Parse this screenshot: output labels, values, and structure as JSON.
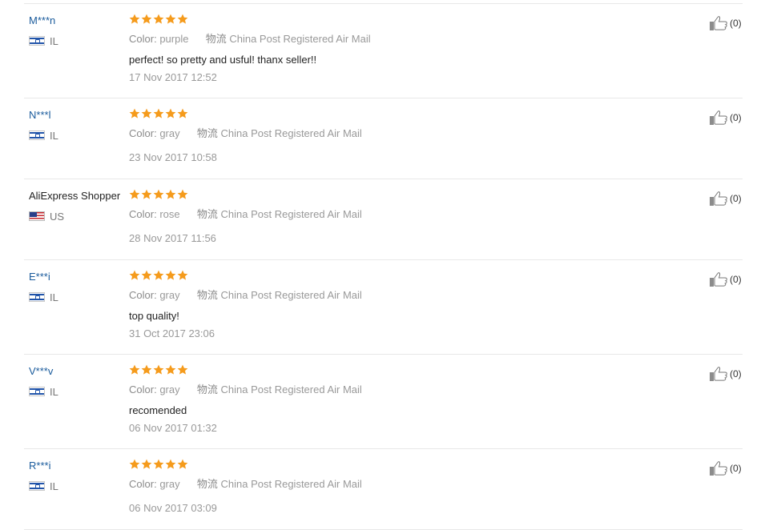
{
  "labels": {
    "color": "Color:",
    "shipping": "物流"
  },
  "reviews": [
    {
      "user": "M***n",
      "name_style": "masked",
      "flag": "il",
      "country": "IL",
      "stars": 5,
      "color": "purple",
      "shipping": "China Post Registered Air Mail",
      "feedback": "perfect! so pretty and usful! thanx seller!!",
      "date": "17 Nov 2017 12:52",
      "helpful": "(0)"
    },
    {
      "user": "N***l",
      "name_style": "masked",
      "flag": "il",
      "country": "IL",
      "stars": 5,
      "color": "gray",
      "shipping": "China Post Registered Air Mail",
      "feedback": "",
      "date": "23 Nov 2017 10:58",
      "helpful": "(0)"
    },
    {
      "user": "AliExpress Shopper",
      "name_style": "plain",
      "flag": "us",
      "country": "US",
      "stars": 5,
      "color": "rose",
      "shipping": "China Post Registered Air Mail",
      "feedback": "",
      "date": "28 Nov 2017 11:56",
      "helpful": "(0)"
    },
    {
      "user": "E***i",
      "name_style": "masked",
      "flag": "il",
      "country": "IL",
      "stars": 5,
      "color": "gray",
      "shipping": "China Post Registered Air Mail",
      "feedback": "top quality!",
      "date": "31 Oct 2017 23:06",
      "helpful": "(0)"
    },
    {
      "user": "V***v",
      "name_style": "masked",
      "flag": "il",
      "country": "IL",
      "stars": 5,
      "color": "gray",
      "shipping": "China Post Registered Air Mail",
      "feedback": "recomended",
      "date": "06 Nov 2017 01:32",
      "helpful": "(0)"
    },
    {
      "user": "R***i",
      "name_style": "masked",
      "flag": "il",
      "country": "IL",
      "stars": 5,
      "color": "gray",
      "shipping": "China Post Registered Air Mail",
      "feedback": "",
      "date": "06 Nov 2017 03:09",
      "helpful": "(0)"
    }
  ]
}
